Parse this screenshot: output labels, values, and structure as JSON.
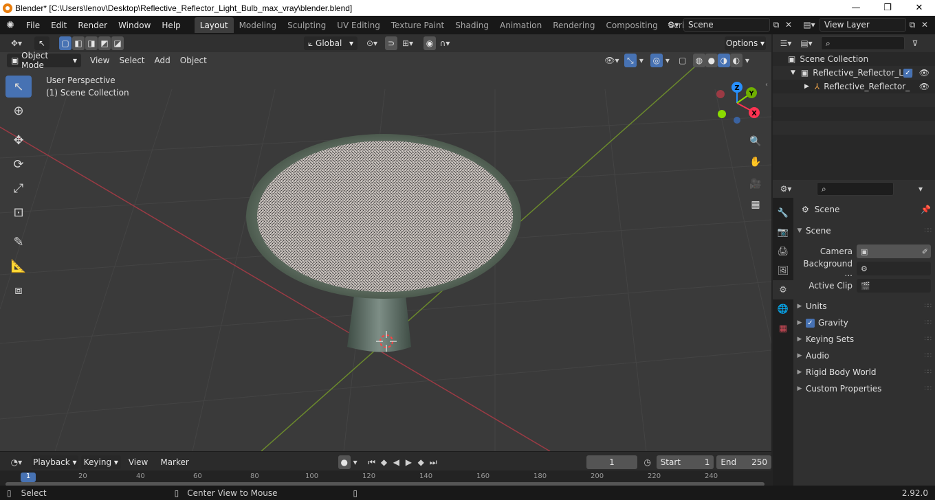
{
  "window": {
    "title": "Blender* [C:\\Users\\lenov\\Desktop\\Reflective_Reflector_Light_Bulb_max_vray\\blender.blend]",
    "minimize": "—",
    "maximize": "❐",
    "close": "✕"
  },
  "menu": [
    "File",
    "Edit",
    "Render",
    "Window",
    "Help"
  ],
  "workspaces": [
    "Layout",
    "Modeling",
    "Sculpting",
    "UV Editing",
    "Texture Paint",
    "Shading",
    "Animation",
    "Rendering",
    "Compositing",
    "Scripting"
  ],
  "active_workspace": "Layout",
  "scene_name": "Scene",
  "view_layer": "View Layer",
  "viewport": {
    "transform_orientation": "Global",
    "options_label": "Options",
    "mode": "Object Mode",
    "header_menus": [
      "View",
      "Select",
      "Add",
      "Object"
    ],
    "perspective_label": "User Perspective",
    "collection_label": "(1) Scene Collection",
    "gizmo": {
      "z": "Z",
      "y": "Y",
      "x": "X"
    }
  },
  "timeline": {
    "menus": [
      "Playback",
      "Keying",
      "View",
      "Marker"
    ],
    "current_frame": "1",
    "start_label": "Start",
    "start": "1",
    "end_label": "End",
    "end": "250",
    "ticks": [
      "1",
      "20",
      "40",
      "60",
      "80",
      "100",
      "120",
      "140",
      "160",
      "180",
      "200",
      "220",
      "240"
    ]
  },
  "statusbar": {
    "left": "Select",
    "middle": "Center View to Mouse",
    "version": "2.92.0"
  },
  "outliner": {
    "root": "Scene Collection",
    "collection": "Reflective_Reflector_Ligl",
    "object": "Reflective_Reflector_"
  },
  "properties": {
    "context": "Scene",
    "panel_title": "Scene",
    "camera_label": "Camera",
    "background_label": "Background ...",
    "active_clip_label": "Active Clip",
    "panels": [
      "Units",
      "Gravity",
      "Keying Sets",
      "Audio",
      "Rigid Body World",
      "Custom Properties"
    ]
  },
  "colors": {
    "accent": "#4772b3",
    "x_axis": "#ff3352",
    "y_axis": "#8bdc00",
    "z_axis": "#2890ff"
  }
}
